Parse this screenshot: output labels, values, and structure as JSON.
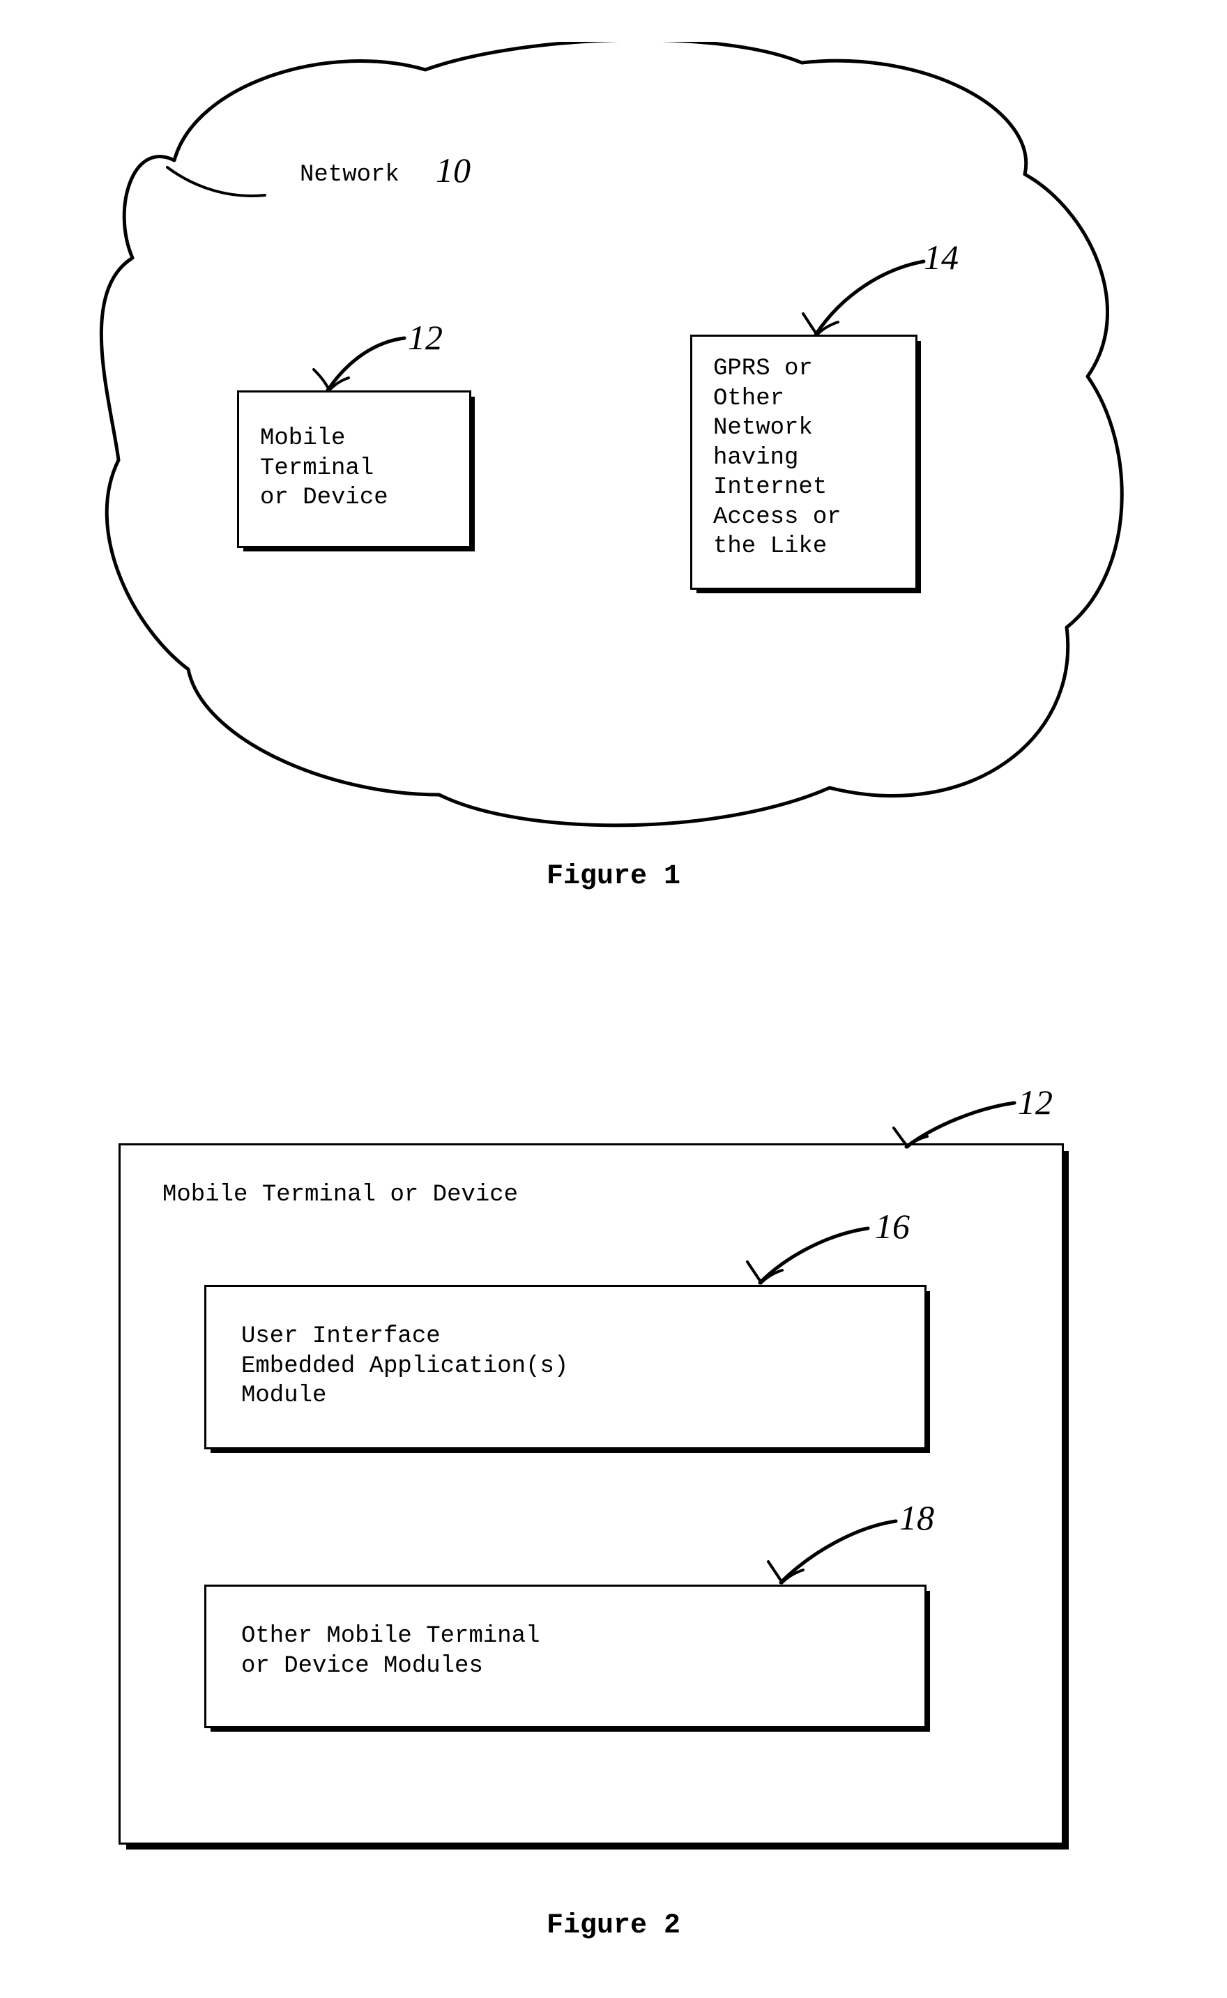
{
  "figure1": {
    "title_text": "Network",
    "title_num": "10",
    "box12": {
      "ref": "12",
      "text": "Mobile\nTerminal\nor Device"
    },
    "box14": {
      "ref": "14",
      "text": "GPRS or\nOther\nNetwork\nhaving\nInternet\nAccess or\nthe Like"
    },
    "caption": "Figure 1"
  },
  "figure2": {
    "outer": {
      "ref": "12",
      "title": "Mobile Terminal or Device"
    },
    "box16": {
      "ref": "16",
      "text": "User Interface\nEmbedded Application(s)\nModule"
    },
    "box18": {
      "ref": "18",
      "text": "Other Mobile Terminal\nor Device Modules"
    },
    "caption": "Figure 2"
  }
}
